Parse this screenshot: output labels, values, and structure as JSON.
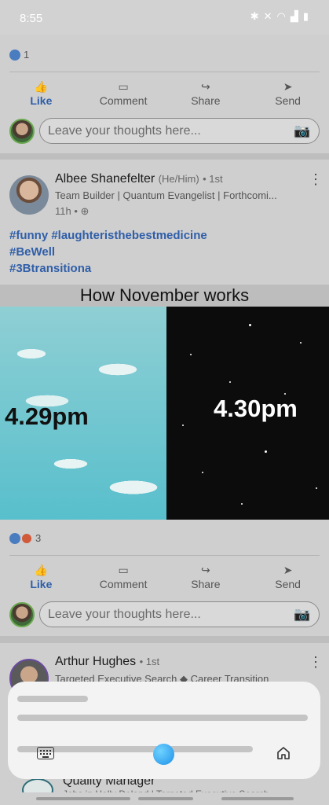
{
  "status_bar": {
    "time": "8:55"
  },
  "post1": {
    "reaction_count": "1",
    "actions": {
      "like": "Like",
      "comment": "Comment",
      "share": "Share",
      "send": "Send"
    },
    "comment_placeholder": "Leave your thoughts here..."
  },
  "post2": {
    "author": "Albee Shanefelter",
    "pronouns": "(He/Him)",
    "degree": "• 1st",
    "headline": "Team Builder | Quantum Evangelist | Forthcomi...",
    "time": "11h •",
    "hashtags": [
      "#funny #laughteristhebestmedicine",
      "#BeWell",
      "#3Btransitiona"
    ],
    "image": {
      "title": "How November works",
      "left_time": "4.29pm",
      "right_time": "4.30pm"
    },
    "reaction_count": "3",
    "actions": {
      "like": "Like",
      "comment": "Comment",
      "share": "Share",
      "send": "Send"
    },
    "comment_placeholder": "Leave your thoughts here..."
  },
  "post3": {
    "author": "Arthur Hughes",
    "degree": "• 1st",
    "headline": "Targeted Executive Search ◆ Career Transition",
    "partial_title": "Quality Manager",
    "partial_sub": "Jobs in Hally Deland | Targeted Executive Search"
  },
  "colors": {
    "accent": "#2f5ea8",
    "overlay": "#f3f3f3",
    "assistant": "#1e8fe8"
  }
}
